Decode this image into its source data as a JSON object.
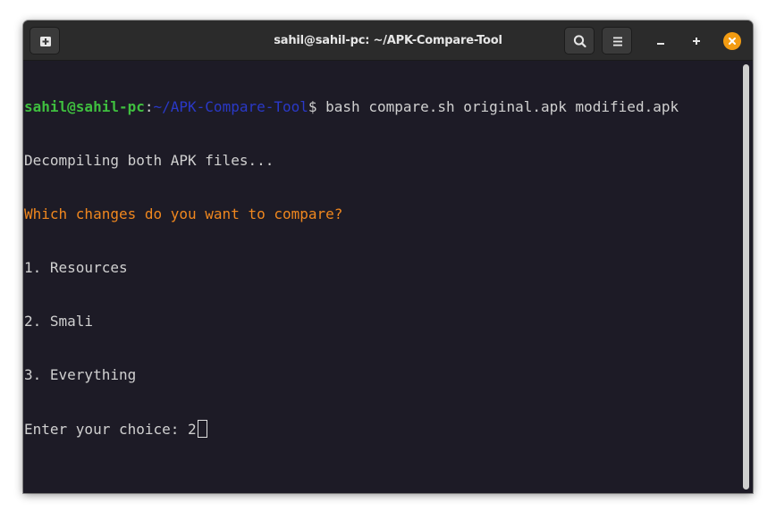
{
  "window": {
    "title": "sahil@sahil-pc: ~/APK-Compare-Tool"
  },
  "titlebar_icons": {
    "new_tab": "new-tab-icon",
    "search": "search-icon",
    "menu": "hamburger-menu-icon",
    "minimize": "minimize-icon",
    "maximize": "maximize-icon",
    "close": "close-icon"
  },
  "colors": {
    "terminal_bg": "#1d1b26",
    "titlebar_bg": "#2b2b2b",
    "prompt_user": "#3fbf3f",
    "prompt_path": "#2a39c8",
    "highlight_text": "#f0871e",
    "close_button": "#f39c12"
  },
  "terminal": {
    "prompt_user": "sahil@sahil-pc",
    "prompt_colon": ":",
    "prompt_path": "~/APK-Compare-Tool",
    "prompt_symbol": "$ ",
    "command": "bash compare.sh original.apk modified.apk",
    "lines": [
      "Decompiling both APK files...",
      "Which changes do you want to compare?",
      "1. Resources",
      "2. Smali",
      "3. Everything"
    ],
    "input_prompt": "Enter your choice: ",
    "input_value": "2"
  }
}
